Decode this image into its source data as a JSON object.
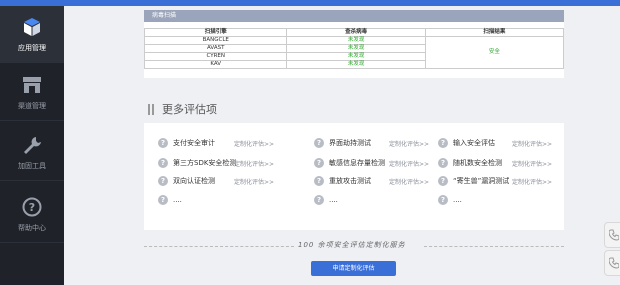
{
  "sidebar": {
    "items": [
      {
        "label": "应用管理",
        "icon": "cube-icon",
        "active": true
      },
      {
        "label": "渠道管理",
        "icon": "store-icon",
        "active": false
      },
      {
        "label": "加固工具",
        "icon": "wrench-icon",
        "active": false
      },
      {
        "label": "帮助中心",
        "icon": "help-icon",
        "active": false
      }
    ]
  },
  "scan": {
    "title": "病毒扫描",
    "headers": [
      "扫描引擎",
      "查杀病毒",
      "扫描结果"
    ],
    "rows": [
      {
        "engine": "BANGCLE",
        "virus": "未发现"
      },
      {
        "engine": "AVAST",
        "virus": "未发现"
      },
      {
        "engine": "CYREN",
        "virus": "未发现"
      },
      {
        "engine": "KAV",
        "virus": "未发现"
      }
    ],
    "result": "安全",
    "result_color": "#2aa52a"
  },
  "more": {
    "title": "更多评估项",
    "items": [
      {
        "label": "支付安全审计",
        "link": "定制化评估>>"
      },
      {
        "label": "界面劫持测试",
        "link": "定制化评估>>"
      },
      {
        "label": "输入安全评估",
        "link": "定制化评估>>"
      },
      {
        "label": "第三方SDK安全检测",
        "link": "定制化评估>>"
      },
      {
        "label": "敏感信息存量检测",
        "link": "定制化评估>>"
      },
      {
        "label": "随机数安全检测",
        "link": "定制化评估>>"
      },
      {
        "label": "双向认证检测",
        "link": "定制化评估>>"
      },
      {
        "label": "重放攻击测试",
        "link": "定制化评估>>"
      },
      {
        "label": "“寄生兽”漏洞测试",
        "link": "定制化评估>>"
      },
      {
        "label": "....",
        "link": ""
      },
      {
        "label": "....",
        "link": ""
      },
      {
        "label": "....",
        "link": ""
      }
    ]
  },
  "footer": {
    "slogan": "100 余项安全评估定制化服务",
    "button": "申请定制化评估"
  },
  "colors": {
    "accent": "#3a6fd8",
    "sidebar": "#1f2228"
  }
}
